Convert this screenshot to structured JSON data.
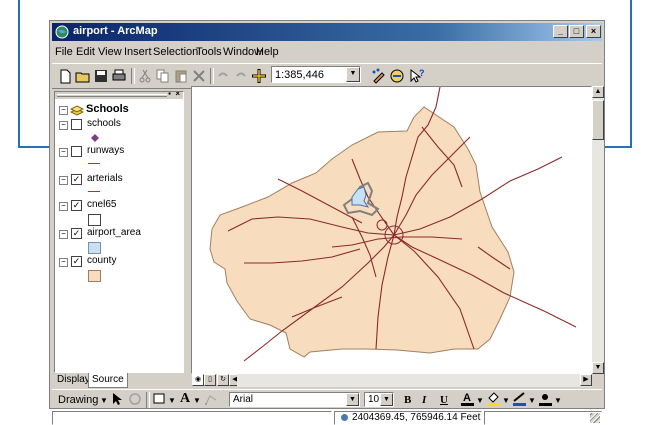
{
  "window": {
    "title": "airport - ArcMap"
  },
  "menu": [
    "File",
    "Edit",
    "View",
    "Insert",
    "Selection",
    "Tools",
    "Window",
    "Help"
  ],
  "toolbar": {
    "scale": "1:385,446"
  },
  "toc": {
    "root": "Schools",
    "layers": [
      {
        "name": "schools",
        "checked": false,
        "symbol": "diamond",
        "color": "#7a3e8c"
      },
      {
        "name": "runways",
        "checked": false,
        "symbol": "line",
        "color": "#7a3e8c"
      },
      {
        "name": "arterials",
        "checked": true,
        "symbol": "line",
        "color": "#c0282a"
      },
      {
        "name": "cnel65",
        "checked": true,
        "symbol": "box",
        "color": "#ffffff"
      },
      {
        "name": "airport_area",
        "checked": true,
        "symbol": "box",
        "color": "#c6e0f5"
      },
      {
        "name": "county",
        "checked": true,
        "symbol": "box",
        "color": "#f7dcbe"
      }
    ],
    "tabs": {
      "display": "Display",
      "source": "Source"
    }
  },
  "drawing": {
    "label": "Drawing",
    "font": "Arial",
    "size": "10",
    "bold": "B",
    "italic": "I",
    "underline": "U",
    "text_tool": "A"
  },
  "status": {
    "coordinates": "2404369.45, 765946.14 Feet"
  },
  "colors": {
    "county_fill": "#f7dcbe",
    "arterial": "#8b2a2a",
    "airport": "#c6e0f5",
    "callout": "#2a6fb0"
  }
}
